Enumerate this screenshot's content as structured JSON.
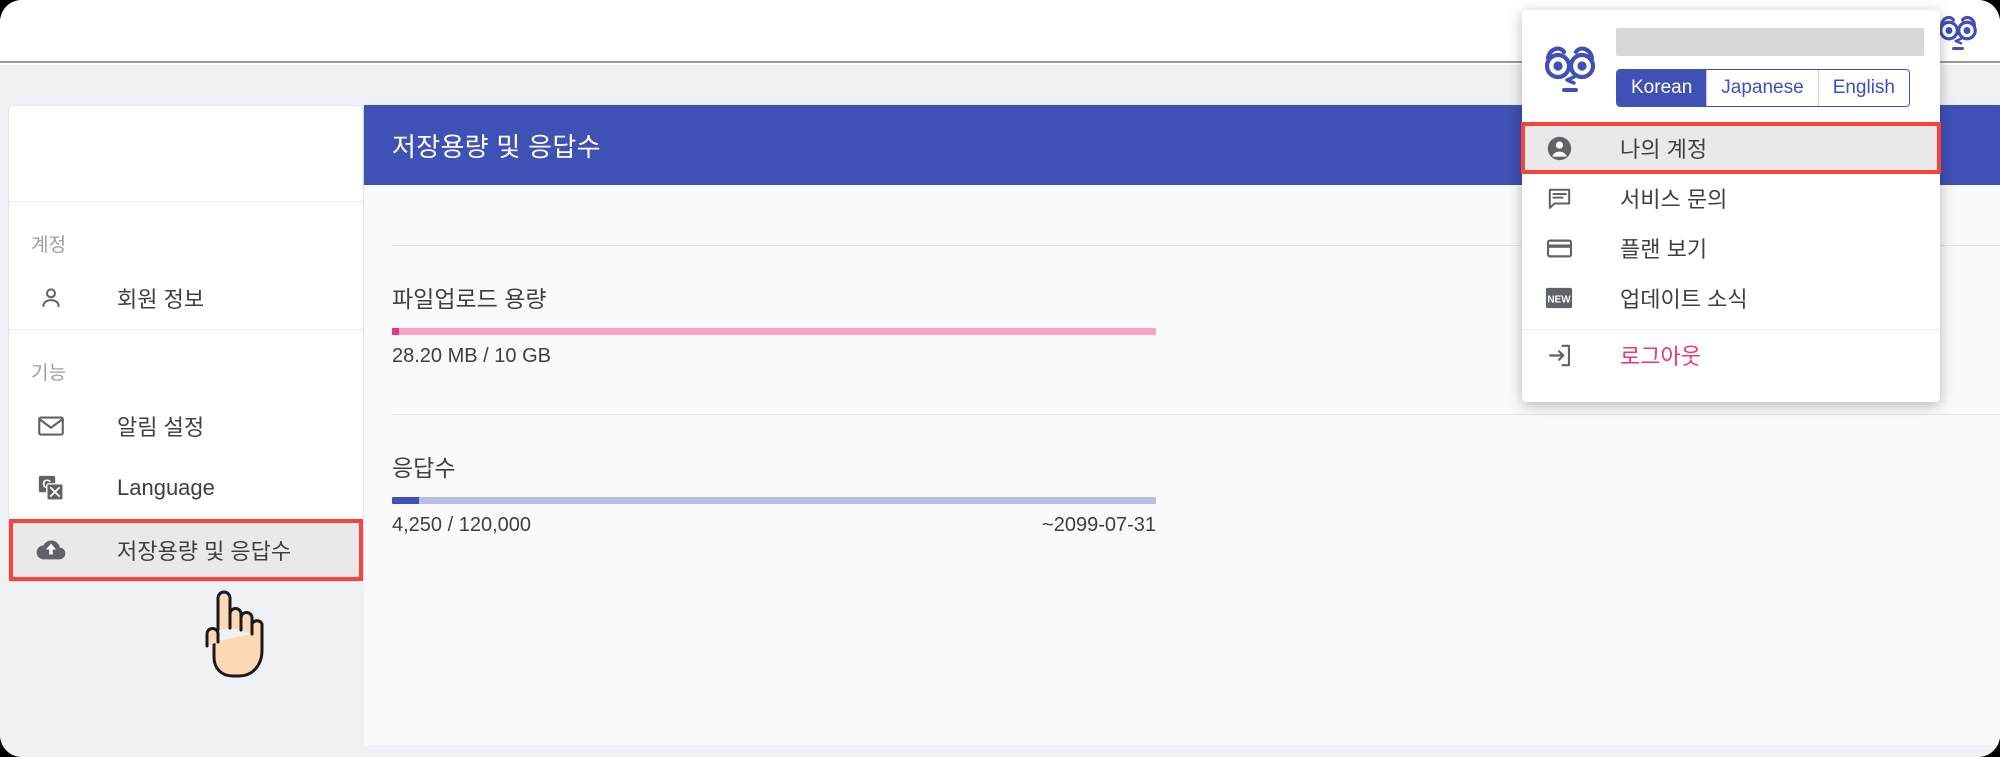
{
  "window": {
    "brand_icon": "owl-logo-icon"
  },
  "sidebar": {
    "groups": [
      {
        "label": "계정",
        "items": [
          {
            "label": "회원 정보",
            "icon": "person-outline-icon",
            "active": false
          }
        ]
      },
      {
        "label": "기능",
        "items": [
          {
            "label": "알림 설정",
            "icon": "mail-icon",
            "active": false
          },
          {
            "label": "Language",
            "icon": "translate-icon",
            "active": false
          },
          {
            "label": "저장용량 및 응답수",
            "icon": "cloud-upload-icon",
            "active": true
          }
        ]
      }
    ]
  },
  "main": {
    "header_title": "저장용량 및 응답수",
    "metrics": [
      {
        "title": "파일업로드 용량",
        "value_text": "28.20 MB / 10 GB",
        "date_text": "",
        "percent": 0.9,
        "fill_color": "#e8357c",
        "track_color": "#f9a3c4"
      },
      {
        "title": "응답수",
        "value_text": "4,250 / 120,000",
        "date_text": "~2099-07-31",
        "percent": 3.5,
        "fill_color": "#3f51b5",
        "track_color": "#b6bee3"
      }
    ]
  },
  "account_dropdown": {
    "owl_icon": "owl-logo-icon",
    "user_name": "",
    "languages": [
      {
        "label": "Korean",
        "selected": true
      },
      {
        "label": "Japanese",
        "selected": false
      },
      {
        "label": "English",
        "selected": false
      }
    ],
    "items": [
      {
        "label": "나의 계정",
        "icon": "account-circle-icon",
        "highlighted": true,
        "logout": false
      },
      {
        "label": "서비스 문의",
        "icon": "chat-bubble-icon",
        "highlighted": false,
        "logout": false
      },
      {
        "label": "플랜 보기",
        "icon": "credit-card-icon",
        "highlighted": false,
        "logout": false
      },
      {
        "label": "업데이트 소식",
        "icon": "new-badge-icon",
        "highlighted": false,
        "logout": false
      },
      {
        "label": "로그아웃",
        "icon": "logout-arrow-icon",
        "highlighted": false,
        "logout": true
      }
    ]
  },
  "colors": {
    "accent_indigo": "#3f51b5",
    "accent_pink": "#e8357c",
    "highlight_red": "#f9423a"
  }
}
